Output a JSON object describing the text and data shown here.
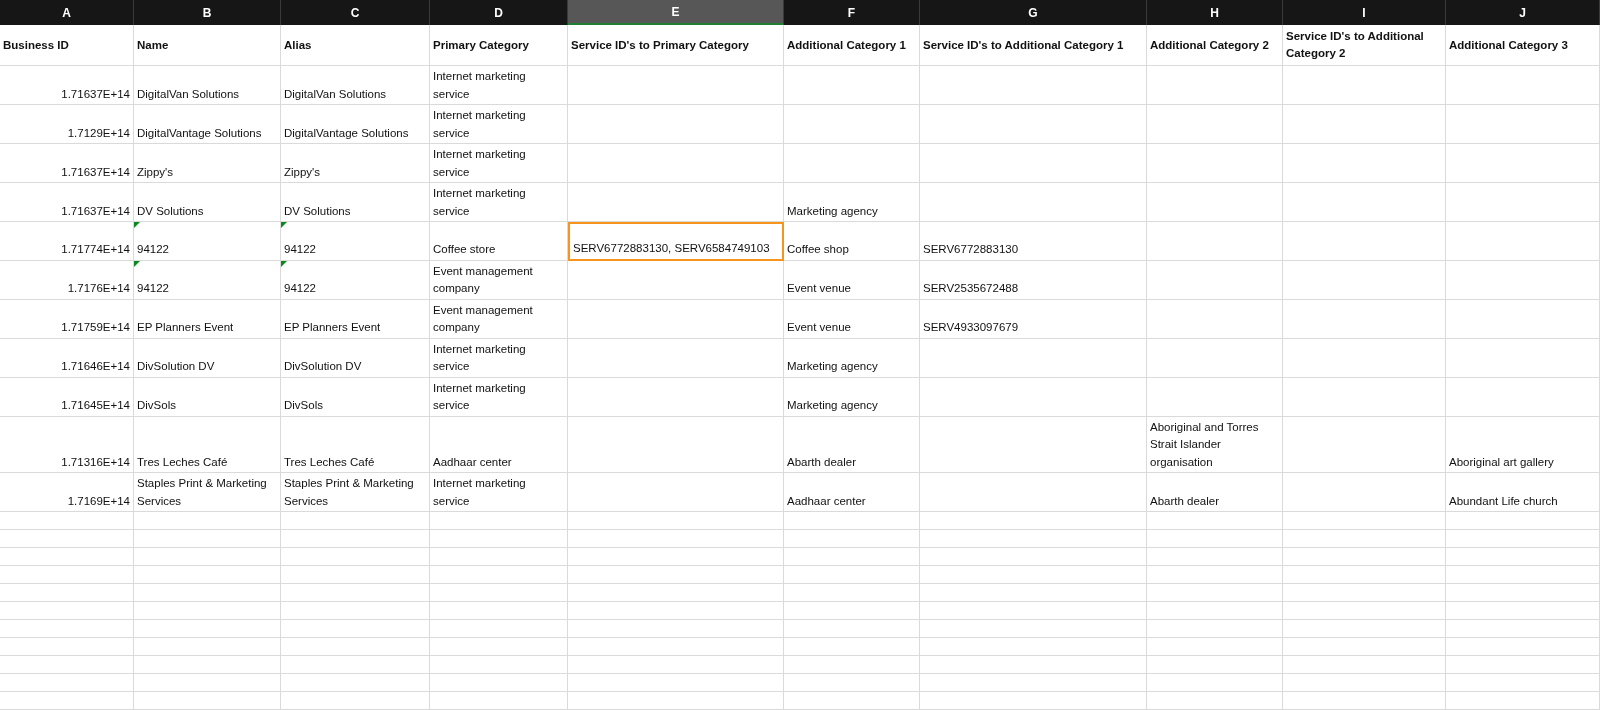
{
  "column_letters": [
    {
      "label": "A",
      "selected": false
    },
    {
      "label": "B",
      "selected": false
    },
    {
      "label": "C",
      "selected": false
    },
    {
      "label": "D",
      "selected": false
    },
    {
      "label": "E",
      "selected": true
    },
    {
      "label": "F",
      "selected": false
    },
    {
      "label": "G",
      "selected": false
    },
    {
      "label": "H",
      "selected": false
    },
    {
      "label": "I",
      "selected": false
    },
    {
      "label": "J",
      "selected": false
    }
  ],
  "header_row": [
    "Business ID",
    "Name",
    "Alias",
    "Primary Category",
    "Service ID's to Primary Category",
    "Additional Category 1",
    "Service ID's to Additional Category 1",
    "Additional Category 2",
    "Service ID's to Additional Category 2",
    "Additional Category 3"
  ],
  "rows": [
    {
      "cells": [
        {
          "text": "1.71637E+14",
          "selected": false,
          "warning": false
        },
        {
          "text": "DigitalVan Solutions",
          "selected": false,
          "warning": false
        },
        {
          "text": "DigitalVan Solutions",
          "selected": false,
          "warning": false
        },
        {
          "text": "Internet marketing service",
          "selected": false,
          "warning": false
        },
        {
          "selected": false,
          "warning": false
        },
        {
          "selected": false,
          "warning": false
        },
        {
          "selected": false,
          "warning": false
        },
        {
          "selected": false,
          "warning": false
        },
        {
          "selected": false,
          "warning": false
        },
        {
          "selected": false,
          "warning": false
        }
      ]
    },
    {
      "cells": [
        {
          "text": "1.7129E+14",
          "selected": false,
          "warning": false
        },
        {
          "text": "DigitalVantage Solutions",
          "selected": false,
          "warning": false
        },
        {
          "text": "DigitalVantage Solutions",
          "selected": false,
          "warning": false
        },
        {
          "text": "Internet marketing service",
          "selected": false,
          "warning": false
        },
        {
          "selected": false,
          "warning": false
        },
        {
          "selected": false,
          "warning": false
        },
        {
          "selected": false,
          "warning": false
        },
        {
          "selected": false,
          "warning": false
        },
        {
          "selected": false,
          "warning": false
        },
        {
          "selected": false,
          "warning": false
        }
      ]
    },
    {
      "cells": [
        {
          "text": "1.71637E+14",
          "selected": false,
          "warning": false
        },
        {
          "text": "Zippy's",
          "selected": false,
          "warning": false
        },
        {
          "text": "Zippy's",
          "selected": false,
          "warning": false
        },
        {
          "text": "Internet marketing service",
          "selected": false,
          "warning": false
        },
        {
          "selected": false,
          "warning": false
        },
        {
          "selected": false,
          "warning": false
        },
        {
          "selected": false,
          "warning": false
        },
        {
          "selected": false,
          "warning": false
        },
        {
          "selected": false,
          "warning": false
        },
        {
          "selected": false,
          "warning": false
        }
      ]
    },
    {
      "cells": [
        {
          "text": "1.71637E+14",
          "selected": false,
          "warning": false
        },
        {
          "text": "DV Solutions",
          "selected": false,
          "warning": false
        },
        {
          "text": "DV Solutions",
          "selected": false,
          "warning": false
        },
        {
          "text": "Internet marketing service",
          "selected": false,
          "warning": false
        },
        {
          "selected": false,
          "warning": false
        },
        {
          "text": "Marketing agency",
          "selected": false,
          "warning": false
        },
        {
          "selected": false,
          "warning": false
        },
        {
          "selected": false,
          "warning": false
        },
        {
          "selected": false,
          "warning": false
        },
        {
          "selected": false,
          "warning": false
        }
      ]
    },
    {
      "cells": [
        {
          "text": "1.71774E+14",
          "selected": false,
          "warning": false
        },
        {
          "text": "94122",
          "selected": false,
          "warning": true
        },
        {
          "text": "94122",
          "selected": false,
          "warning": true
        },
        {
          "text": "Coffee store",
          "selected": false,
          "warning": false
        },
        {
          "text": "SERV6772883130, SERV6584749103",
          "selected": true,
          "warning": false
        },
        {
          "text": "Coffee shop",
          "selected": false,
          "warning": false
        },
        {
          "text": "SERV6772883130",
          "selected": false,
          "warning": false
        },
        {
          "selected": false,
          "warning": false
        },
        {
          "selected": false,
          "warning": false
        },
        {
          "selected": false,
          "warning": false
        }
      ]
    },
    {
      "cells": [
        {
          "text": "1.7176E+14",
          "selected": false,
          "warning": false
        },
        {
          "text": "94122",
          "selected": false,
          "warning": true
        },
        {
          "text": "94122",
          "selected": false,
          "warning": true
        },
        {
          "text": "Event management company",
          "selected": false,
          "warning": false
        },
        {
          "selected": false,
          "warning": false
        },
        {
          "text": "Event venue",
          "selected": false,
          "warning": false
        },
        {
          "text": "SERV2535672488",
          "selected": false,
          "warning": false
        },
        {
          "selected": false,
          "warning": false
        },
        {
          "selected": false,
          "warning": false
        },
        {
          "selected": false,
          "warning": false
        }
      ]
    },
    {
      "cells": [
        {
          "text": "1.71759E+14",
          "selected": false,
          "warning": false
        },
        {
          "text": "EP Planners Event",
          "selected": false,
          "warning": false
        },
        {
          "text": "EP Planners Event",
          "selected": false,
          "warning": false
        },
        {
          "text": "Event management company",
          "selected": false,
          "warning": false
        },
        {
          "selected": false,
          "warning": false
        },
        {
          "text": "Event venue",
          "selected": false,
          "warning": false
        },
        {
          "text": "SERV4933097679",
          "selected": false,
          "warning": false
        },
        {
          "selected": false,
          "warning": false
        },
        {
          "selected": false,
          "warning": false
        },
        {
          "selected": false,
          "warning": false
        }
      ]
    },
    {
      "cells": [
        {
          "text": "1.71646E+14",
          "selected": false,
          "warning": false
        },
        {
          "text": "DivSolution DV",
          "selected": false,
          "warning": false
        },
        {
          "text": "DivSolution DV",
          "selected": false,
          "warning": false
        },
        {
          "text": "Internet marketing service",
          "selected": false,
          "warning": false
        },
        {
          "selected": false,
          "warning": false
        },
        {
          "text": "Marketing agency",
          "selected": false,
          "warning": false
        },
        {
          "selected": false,
          "warning": false
        },
        {
          "selected": false,
          "warning": false
        },
        {
          "selected": false,
          "warning": false
        },
        {
          "selected": false,
          "warning": false
        }
      ]
    },
    {
      "cells": [
        {
          "text": "1.71645E+14",
          "selected": false,
          "warning": false
        },
        {
          "text": "DivSols",
          "selected": false,
          "warning": false
        },
        {
          "text": "DivSols",
          "selected": false,
          "warning": false
        },
        {
          "text": "Internet marketing service",
          "selected": false,
          "warning": false
        },
        {
          "selected": false,
          "warning": false
        },
        {
          "text": "Marketing agency",
          "selected": false,
          "warning": false
        },
        {
          "selected": false,
          "warning": false
        },
        {
          "selected": false,
          "warning": false
        },
        {
          "selected": false,
          "warning": false
        },
        {
          "selected": false,
          "warning": false
        }
      ]
    },
    {
      "cells": [
        {
          "text": "1.71316E+14",
          "selected": false,
          "warning": false
        },
        {
          "text": "Tres Leches Café",
          "selected": false,
          "warning": false
        },
        {
          "text": "Tres Leches Café",
          "selected": false,
          "warning": false
        },
        {
          "text": "Aadhaar center",
          "selected": false,
          "warning": false
        },
        {
          "selected": false,
          "warning": false
        },
        {
          "text": "Abarth dealer",
          "selected": false,
          "warning": false
        },
        {
          "selected": false,
          "warning": false
        },
        {
          "text": "Aboriginal and Torres Strait Islander organisation",
          "selected": false,
          "warning": false
        },
        {
          "selected": false,
          "warning": false
        },
        {
          "text": "Aboriginal art gallery",
          "selected": false,
          "warning": false
        }
      ]
    },
    {
      "cells": [
        {
          "text": "1.7169E+14",
          "selected": false,
          "warning": false
        },
        {
          "text": "Staples Print & Marketing Services",
          "selected": false,
          "warning": false
        },
        {
          "text": "Staples Print & Marketing Services",
          "selected": false,
          "warning": false
        },
        {
          "text": "Internet marketing service",
          "selected": false,
          "warning": false
        },
        {
          "selected": false,
          "warning": false
        },
        {
          "text": "Aadhaar center",
          "selected": false,
          "warning": false
        },
        {
          "selected": false,
          "warning": false
        },
        {
          "text": "Abarth dealer",
          "selected": false,
          "warning": false
        },
        {
          "selected": false,
          "warning": false
        },
        {
          "text": "Abundant Life church",
          "selected": false,
          "warning": false
        }
      ]
    }
  ]
}
